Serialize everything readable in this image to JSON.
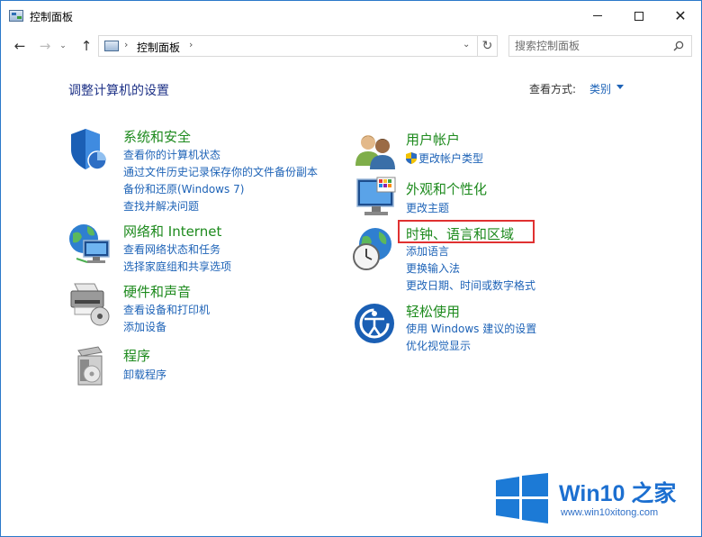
{
  "window": {
    "title": "控制面板",
    "minimize_glyph": "",
    "close_glyph": "✕"
  },
  "nav": {
    "back_glyph": "←",
    "forward_glyph": "→",
    "recent_glyph": "⌄",
    "up_glyph": "↑",
    "breadcrumb": [
      "控制面板"
    ],
    "separator": "›",
    "dropdown_glyph": "⌄",
    "refresh_glyph": "↻"
  },
  "search": {
    "placeholder": "搜索控制面板"
  },
  "main": {
    "heading": "调整计算机的设置",
    "view_by_label": "查看方式:",
    "view_by_value": "类别"
  },
  "categories_left": [
    {
      "icon": "system-security-icon",
      "title": "系统和安全",
      "links": [
        "查看你的计算机状态",
        "通过文件历史记录保存你的文件备份副本",
        "备份和还原(Windows 7)",
        "查找并解决问题"
      ]
    },
    {
      "icon": "network-internet-icon",
      "title": "网络和 Internet",
      "links": [
        "查看网络状态和任务",
        "选择家庭组和共享选项"
      ]
    },
    {
      "icon": "hardware-sound-icon",
      "title": "硬件和声音",
      "links": [
        "查看设备和打印机",
        "添加设备"
      ]
    },
    {
      "icon": "programs-icon",
      "title": "程序",
      "links": [
        "卸载程序"
      ]
    }
  ],
  "categories_right": [
    {
      "icon": "user-accounts-icon",
      "title": "用户帐户",
      "links": [
        "更改帐户类型"
      ]
    },
    {
      "icon": "appearance-icon",
      "title": "外观和个性化",
      "links": [
        "更改主题"
      ]
    },
    {
      "icon": "clock-region-icon",
      "title": "时钟、语言和区域",
      "links": [
        "添加语言",
        "更换输入法",
        "更改日期、时间或数字格式"
      ]
    },
    {
      "icon": "ease-of-access-icon",
      "title": "轻松使用",
      "links": [
        "使用 Windows 建议的设置",
        "优化视觉显示"
      ]
    }
  ],
  "watermark": {
    "brand": "Win10",
    "brand_suffix": "之家",
    "url": "www.win10xitong.com"
  },
  "colors": {
    "link": "#1e63b7",
    "category_title": "#1d8a1d",
    "heading": "#1e3287",
    "highlight_border": "#e03131",
    "window_border": "#2b79c9"
  }
}
